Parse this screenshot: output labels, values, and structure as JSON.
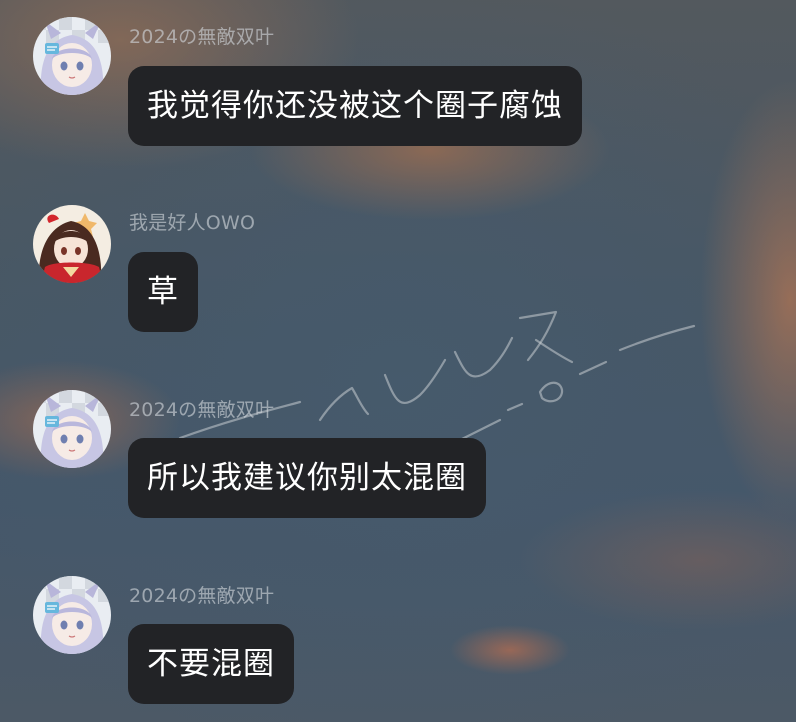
{
  "messages": [
    {
      "sender": "2024の無敵双叶",
      "text": "我觉得你还没被这个圈子腐蚀",
      "avatar_icon": "anime-girl-lavender-hair-avatar-icon"
    },
    {
      "sender": "我是好人OWO",
      "text": "草",
      "avatar_icon": "anime-girl-red-outfit-avatar-icon"
    },
    {
      "sender": "2024の無敵双叶",
      "text": "所以我建议你别太混圈",
      "avatar_icon": "anime-girl-lavender-hair-avatar-icon"
    },
    {
      "sender": "2024の無敵双叶",
      "text": "不要混圈",
      "avatar_icon": "anime-girl-lavender-hair-avatar-icon"
    }
  ],
  "colors": {
    "bubble_bg": "#222326",
    "bubble_text": "#ffffff",
    "sender_text": "#c9ced6"
  }
}
